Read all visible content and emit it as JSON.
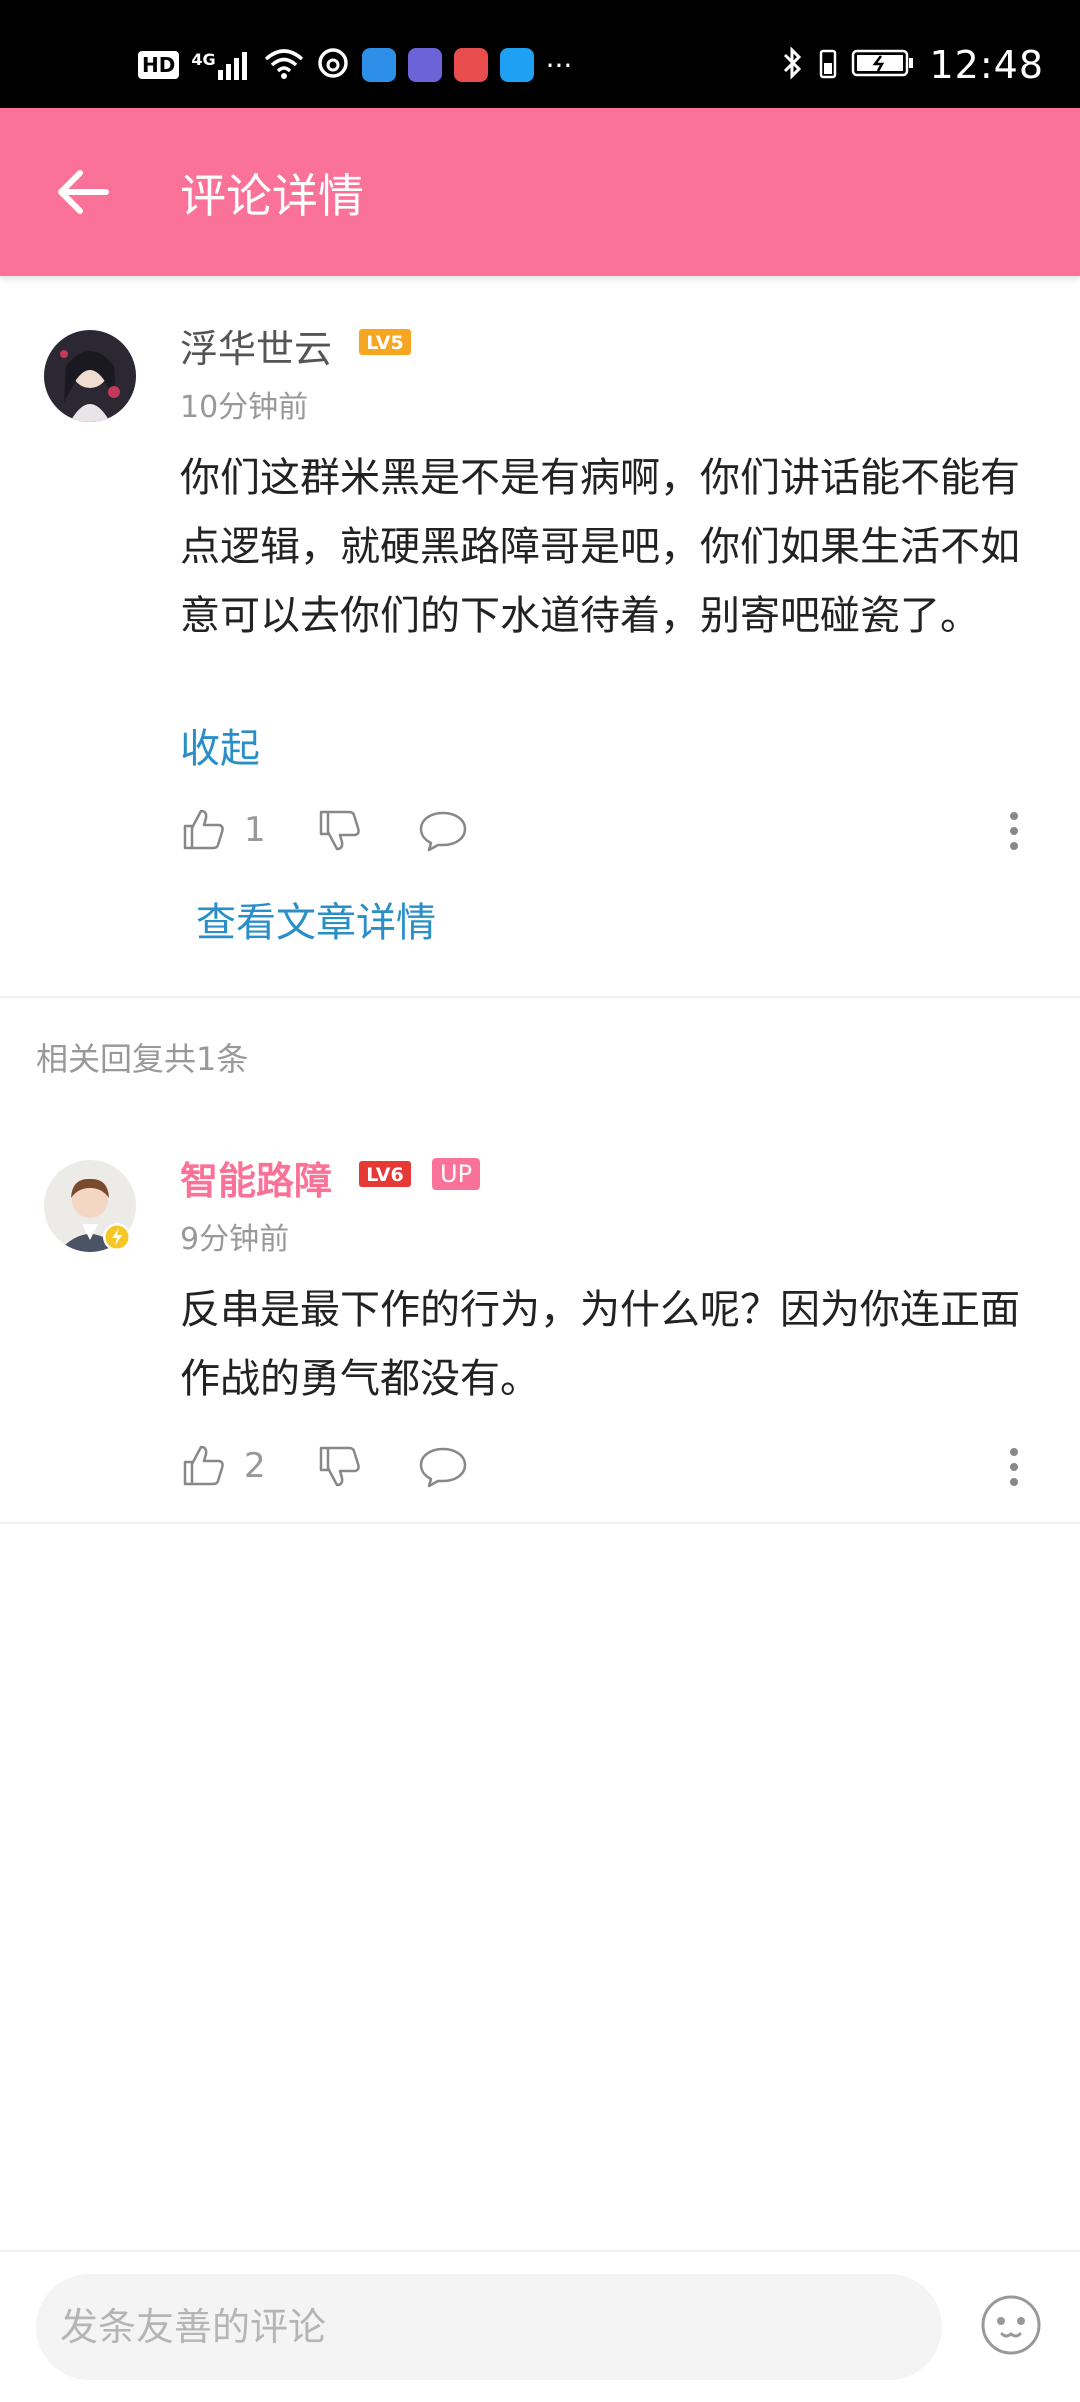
{
  "status_bar": {
    "network_badge": "HD",
    "network_type": "4G",
    "time": "12:48",
    "overflow": "···"
  },
  "header": {
    "title": "评论详情",
    "accent_color": "#fb7299"
  },
  "main_comment": {
    "username": "浮华世云",
    "level": "LV5",
    "level_color": "#f5a623",
    "time": "10分钟前",
    "text": "你们这群米黑是不是有病啊，你们讲话能不能有点逻辑，就硬黑路障哥是吧，你们如果生活不如意可以去你们的下水道待着，别寄吧碰瓷了。",
    "collapse_label": "收起",
    "likes": "1",
    "view_article_label": "查看文章详情"
  },
  "replies_section": {
    "label": "相关回复共1条"
  },
  "reply": {
    "username": "智能路障",
    "username_color": "#fb7299",
    "level": "LV6",
    "level_color": "#e53935",
    "up_badge": "UP",
    "time": "9分钟前",
    "text": "反串是最下作的行为，为什么呢？因为你连正面作战的勇气都没有。",
    "likes": "2"
  },
  "bottom_bar": {
    "input_placeholder": "发条友善的评论"
  },
  "icons": {
    "back": "arrow-left-icon",
    "like": "thumb-up-icon",
    "dislike": "thumb-down-icon",
    "reply": "speech-bubble-icon",
    "more": "more-vertical-icon",
    "emoji": "emoji-face-icon"
  }
}
